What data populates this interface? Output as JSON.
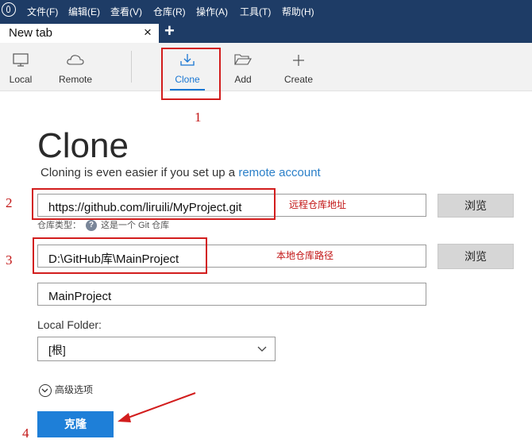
{
  "menubar": {
    "items": [
      "文件(F)",
      "编辑(E)",
      "查看(V)",
      "仓库(R)",
      "操作(A)",
      "工具(T)",
      "帮助(H)"
    ]
  },
  "tabs": {
    "active_title": "New tab",
    "close_glyph": "×",
    "add_glyph": "+"
  },
  "toolbar": {
    "items": [
      {
        "label": "Local",
        "icon": "monitor-icon"
      },
      {
        "label": "Remote",
        "icon": "cloud-icon"
      },
      {
        "label": "Clone",
        "icon": "download-icon",
        "active": true
      },
      {
        "label": "Add",
        "icon": "folder-open-icon"
      },
      {
        "label": "Create",
        "icon": "plus-icon"
      }
    ]
  },
  "main": {
    "title": "Clone",
    "subtitle_text": "Cloning is even easier if you set up a",
    "subtitle_link": "remote account",
    "source_url": "https://github.com/liruili/MyProject.git",
    "repo_type_label": "仓库类型：",
    "repo_type_value": "这是一个 Git 仓库",
    "help_glyph": "?",
    "destination_path": "D:\\GitHub库\\MainProject",
    "repo_name": "MainProject",
    "browse_label_1": "浏览",
    "browse_label_2": "浏览",
    "local_folder_label": "Local Folder:",
    "local_folder_value": "[根]",
    "advanced_label": "高级选项",
    "clone_button": "克隆"
  },
  "annotations": {
    "num_1": "1",
    "num_2": "2",
    "num_3": "3",
    "num_4": "4",
    "remote_repo_address": "远程仓库地址",
    "local_repo_path": "本地仓库路径",
    "color": "#d21d1d"
  },
  "colors": {
    "menubar_bg": "#1e3c66",
    "accent": "#1976d2",
    "primary_button": "#1e7fd8"
  }
}
